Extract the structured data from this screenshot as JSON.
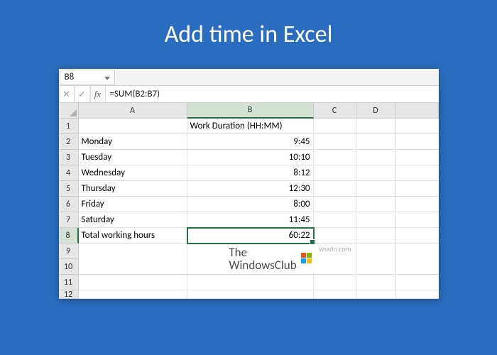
{
  "title": "Add time in Excel",
  "nameBox": "B8",
  "inputs": {
    "cancel": "✕",
    "confirm": "✓",
    "fx": "fx"
  },
  "formula": "=SUM(B2:B7)",
  "columns": [
    "A",
    "B",
    "C",
    "D"
  ],
  "activeColumnIndex": 1,
  "rows": [
    1,
    2,
    3,
    4,
    5,
    6,
    7,
    8,
    9,
    10,
    11,
    12
  ],
  "activeRowIndex": 7,
  "headerRow": {
    "b": "Work Duration (HH:MM)"
  },
  "data": [
    {
      "day": "Monday",
      "duration": "9:45"
    },
    {
      "day": "Tuesday",
      "duration": "10:10"
    },
    {
      "day": "Wednesday",
      "duration": "8:12"
    },
    {
      "day": "Thursday",
      "duration": "12:30"
    },
    {
      "day": "Friday",
      "duration": "8:00"
    },
    {
      "day": "Saturday",
      "duration": "11:45"
    }
  ],
  "total": {
    "label": "Total working hours",
    "value": "60:22"
  },
  "watermark": {
    "line1": "The",
    "line2": "WindowsClub",
    "domain": "wsxdn.com"
  }
}
